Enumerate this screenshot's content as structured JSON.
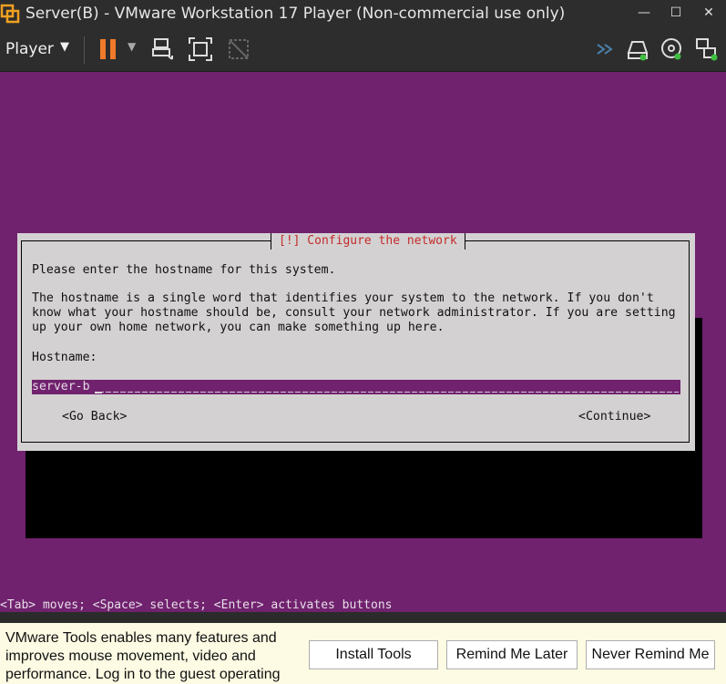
{
  "window": {
    "title": "Server(B) - VMware Workstation 17 Player (Non-commercial use only)",
    "controls": {
      "minimize": "—",
      "maximize": "☐",
      "close": "✕"
    }
  },
  "toolbar": {
    "player_menu": "Player",
    "icons": [
      "pause-icon",
      "send-ctrl-alt-del-icon",
      "full-screen-icon",
      "unity-icon",
      "forward-icon",
      "hard-disk-icon",
      "cd-dvd-icon",
      "network-adapter-icon"
    ],
    "accent_color": "#f07a2a"
  },
  "console": {
    "background_color": "#70226e",
    "dialog": {
      "title": "[!] Configure the network",
      "prompt": "Please enter the hostname for this system.",
      "description": [
        "The hostname is a single word that identifies your system to the network. If you don't",
        "know what your hostname should be, consult your network administrator. If you are setting",
        "up your own home network, you can make something up here."
      ],
      "field_label": "Hostname:",
      "hostname_value": "server-b",
      "go_back": "<Go Back>",
      "continue": "<Continue>"
    },
    "status_line": "<Tab> moves; <Space> selects; <Enter> activates buttons"
  },
  "notification": {
    "message": "VMware Tools enables many features and improves mouse movement, video and performance. Log in to the guest operating",
    "install_tools": "Install Tools",
    "remind_later": "Remind Me Later",
    "never_remind": "Never Remind Me"
  }
}
